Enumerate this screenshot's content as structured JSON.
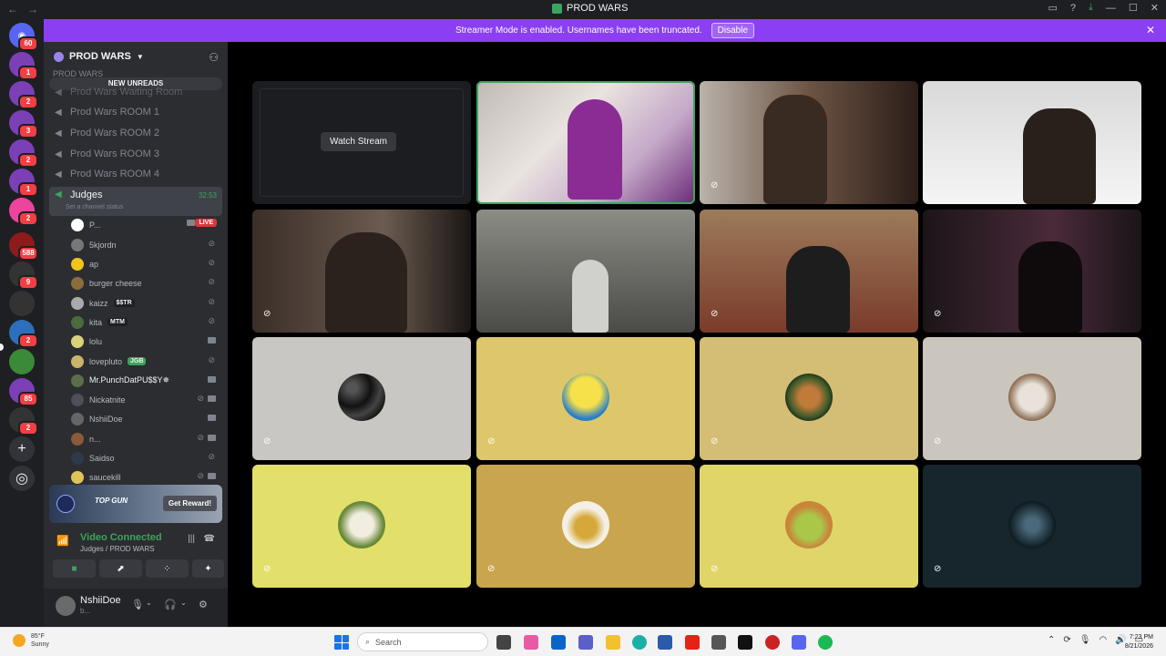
{
  "window": {
    "title": "PROD WARS"
  },
  "banner": {
    "text": "Streamer Mode is enabled. Usernames have been truncated.",
    "disable_label": "Disable"
  },
  "rail": {
    "home_badge": "60",
    "servers": [
      {
        "badge": "1"
      },
      {
        "badge": "2"
      },
      {
        "badge": "3"
      },
      {
        "badge": "2"
      },
      {
        "badge": "1"
      },
      {
        "badge": "2"
      },
      {
        "badge": "588"
      },
      {
        "badge": "9"
      },
      {
        "badge": ""
      },
      {
        "badge": "2"
      },
      {
        "badge": ""
      },
      {
        "badge": "85"
      },
      {
        "badge": "2"
      }
    ]
  },
  "sidebar": {
    "guild_name": "PROD WARS",
    "category": "PROD WARS",
    "new_unreads": "NEW UNREADS",
    "channels": [
      {
        "name": "Prod Wars Waiting Room"
      },
      {
        "name": "Prod Wars ROOM 1"
      },
      {
        "name": "Prod Wars ROOM 2"
      },
      {
        "name": "Prod Wars ROOM 3"
      },
      {
        "name": "Prod Wars ROOM 4"
      }
    ],
    "active_channel": {
      "name": "Judges",
      "timer": "32:53",
      "status": "Set a channel status"
    },
    "members": [
      {
        "name": "P...",
        "tag": "",
        "live": "LIVE"
      },
      {
        "name": "5kjordn",
        "tag": ""
      },
      {
        "name": "ap",
        "tag": ""
      },
      {
        "name": "burger cheese",
        "tag": ""
      },
      {
        "name": "kaizz",
        "tag": "$$TR"
      },
      {
        "name": "kita",
        "tag": "MTM"
      },
      {
        "name": "lolu",
        "tag": ""
      },
      {
        "name": "lovepluto",
        "tag": "JGB"
      },
      {
        "name": "Mr.PunchDatPU$$Y✵",
        "tag": ""
      },
      {
        "name": "Nickatnite",
        "tag": ""
      },
      {
        "name": "NshiiDoe",
        "tag": ""
      },
      {
        "name": "n...",
        "tag": ""
      },
      {
        "name": "Saidso",
        "tag": ""
      },
      {
        "name": "saucekill",
        "tag": ""
      }
    ],
    "promo": {
      "title": "TOP GUN",
      "button": "Get Reward!"
    },
    "voice": {
      "status": "Video Connected",
      "location": "Judges / PROD WARS"
    },
    "user": {
      "name": "NshiiDoe",
      "sub": "b..."
    }
  },
  "stage": {
    "watch_label": "Watch Stream"
  },
  "taskbar": {
    "temp": "85°F",
    "weather": "Sunny",
    "search_placeholder": "Search",
    "time": "7:23 PM",
    "date": "8/21/2026"
  },
  "colors": {
    "accent": "#8a3ff2",
    "connected": "#3ba55d",
    "live": "#da373c",
    "background": "#2b2d31"
  }
}
